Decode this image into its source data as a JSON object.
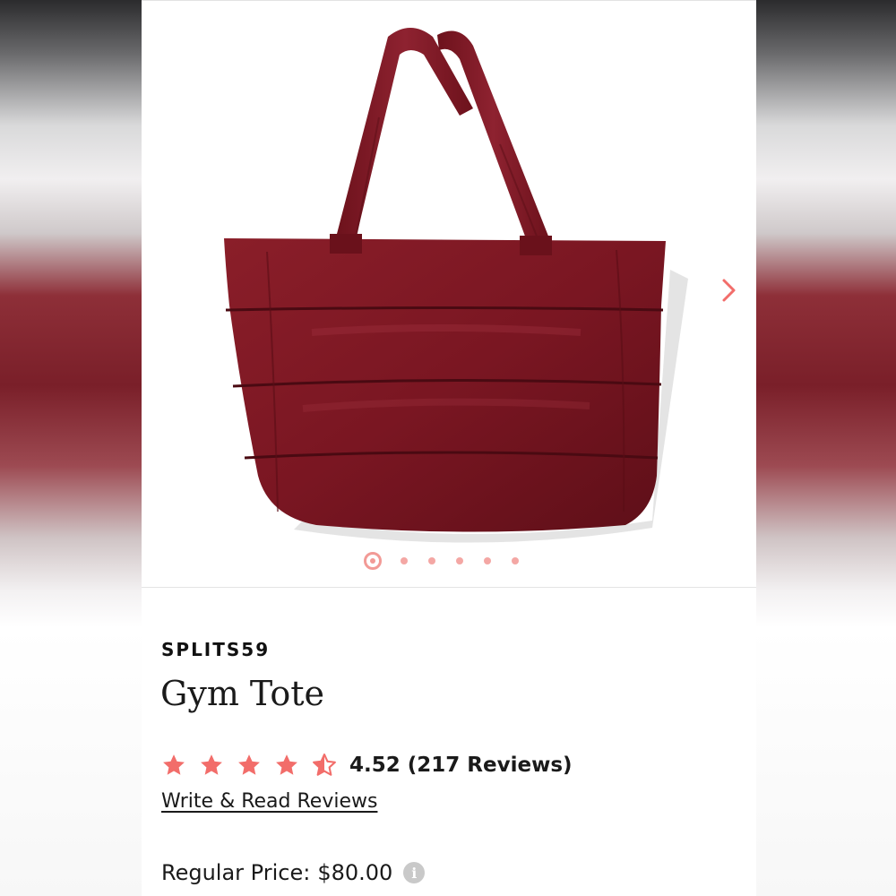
{
  "product": {
    "brand": "SPLITS59",
    "title": "Gym Tote",
    "rating_value": 4.52,
    "rating_text": "4.52 (217 Reviews)",
    "reviews_link": "Write & Read Reviews",
    "price_label": "Regular Price:",
    "price_value": "$80.00",
    "image_icon": "tote-bag-image",
    "accent_color": "#f26d6a"
  },
  "gallery": {
    "slide_count": 6,
    "active_slide": 1,
    "next_icon": "chevron-right-icon"
  },
  "icons": {
    "info": "i"
  }
}
